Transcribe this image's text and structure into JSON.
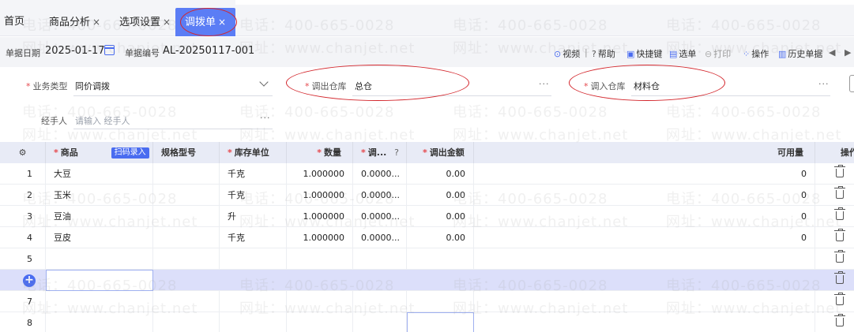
{
  "tabs": [
    {
      "label": "首页",
      "closable": false
    },
    {
      "label": "商品分析",
      "closable": true
    },
    {
      "label": "选项设置",
      "closable": true
    },
    {
      "label": "调拨单",
      "closable": true,
      "active": true
    }
  ],
  "close_glyph": "×",
  "header": {
    "date_label": "单据日期",
    "date_value": "2025-01-17",
    "number_label": "单据编号",
    "number_value": "AL-20250117-001"
  },
  "toolbar": {
    "video": "视频",
    "help": "帮助",
    "shortcut": "快捷键",
    "select": "选单",
    "print": "打印",
    "operate": "操作",
    "history": "历史单据",
    "separator": "|"
  },
  "form": {
    "biz_type_label": "业务类型",
    "biz_type_value": "同价调拨",
    "out_wh_label": "调出仓库",
    "out_wh_value": "总仓",
    "in_wh_label": "调入仓库",
    "in_wh_value": "材料仓",
    "handler_label": "经手人",
    "handler_placeholder": "请输入 经手人",
    "required_mark": "*",
    "more": "···"
  },
  "table": {
    "columns": {
      "product": "商品",
      "scan": "扫码录入",
      "spec": "规格型号",
      "unit": "库存单位",
      "qty": "数量",
      "price": "调...",
      "amount": "调出金额",
      "available": "可用量",
      "ops": "操作"
    },
    "rows": [
      {
        "no": "1",
        "product": "大豆",
        "unit": "千克",
        "qty": "1.000000",
        "price": "0.0000...",
        "amount": "0.00",
        "available": "0"
      },
      {
        "no": "2",
        "product": "玉米",
        "unit": "千克",
        "qty": "1.000000",
        "price": "0.0000...",
        "amount": "0.00",
        "available": "0"
      },
      {
        "no": "3",
        "product": "豆油",
        "unit": "升",
        "qty": "1.000000",
        "price": "0.0000...",
        "amount": "0.00",
        "available": "0"
      },
      {
        "no": "4",
        "product": "豆皮",
        "unit": "千克",
        "qty": "1.000000",
        "price": "0.0000...",
        "amount": "0.00",
        "available": "0"
      },
      {
        "no": "5"
      },
      {
        "no": "+"
      },
      {
        "no": "7"
      },
      {
        "no": "8"
      }
    ]
  },
  "watermark": {
    "phone": "电话：400-665-0028",
    "site": "网址：www.chanjet.net"
  },
  "colors": {
    "accent": "#4a6cf0",
    "active_tab": "#5b7df5",
    "annotation": "#d3262c",
    "required": "#e5484d",
    "highlight_row": "#dcdffa"
  }
}
